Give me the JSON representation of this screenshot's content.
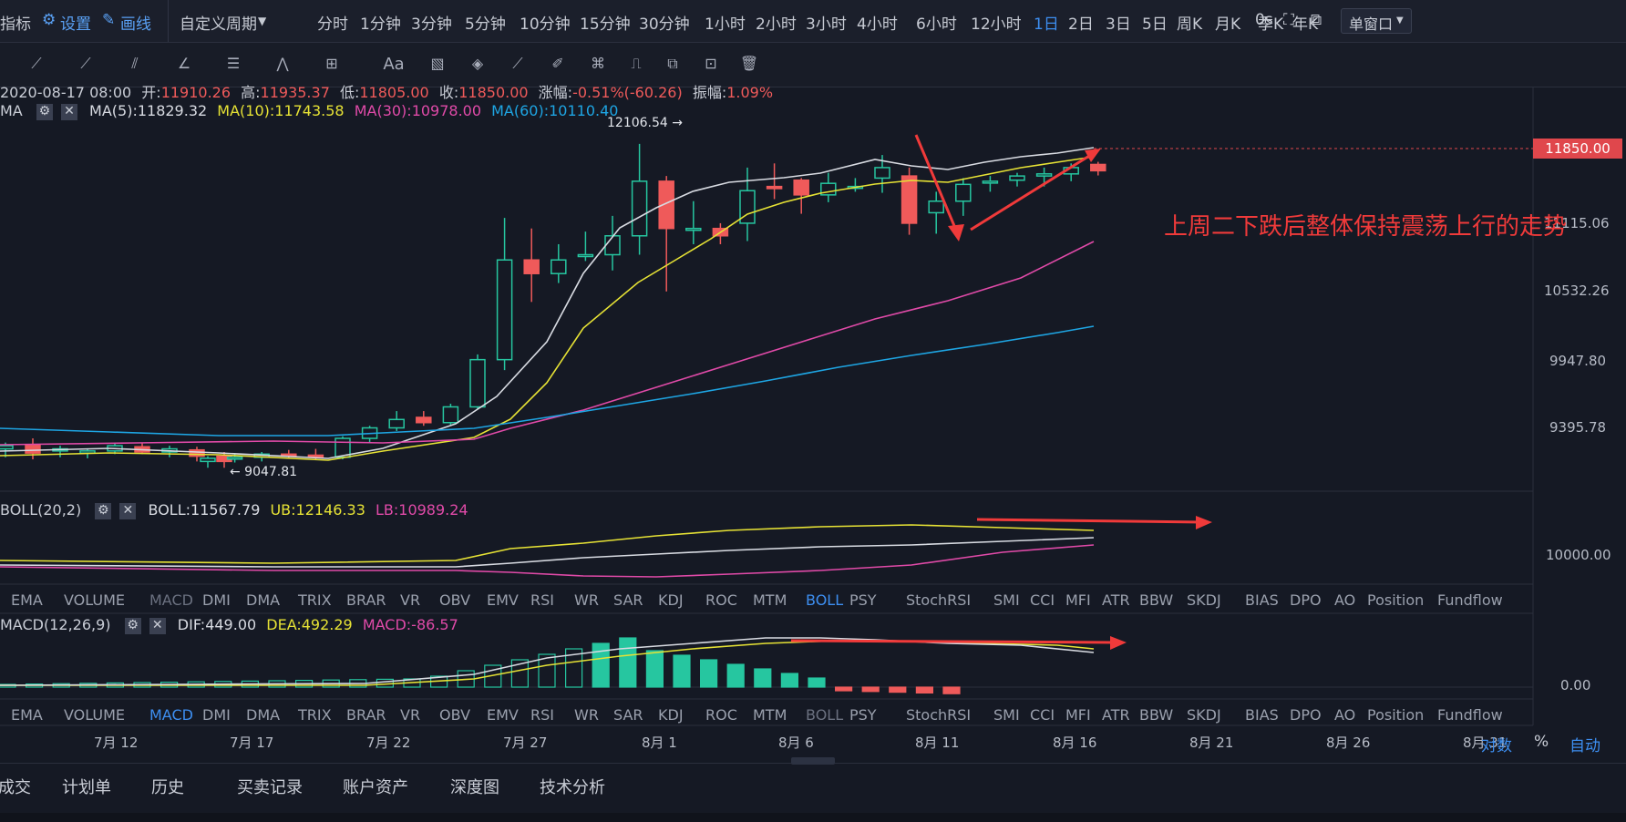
{
  "topbar": {
    "indicators_label": "指标",
    "settings_label": "设置",
    "draw_label": "画线",
    "custom_period_label": "自定义周期",
    "periods": [
      "分时",
      "1分钟",
      "3分钟",
      "5分钟",
      "10分钟",
      "15分钟",
      "30分钟",
      "1小时",
      "2小时",
      "3小时",
      "4小时",
      "6小时",
      "12小时",
      "1日",
      "2日",
      "3日",
      "5日",
      "周K",
      "月K",
      "季K",
      "年K"
    ],
    "active_period": "1日",
    "timer": "0s",
    "window_mode": "单窗口"
  },
  "toolbar": {
    "tools": [
      "line-tool",
      "ray-tool",
      "parallel-tool",
      "angle-tool",
      "fib-tool",
      "wave-tool",
      "box-tool",
      "text-tool",
      "brush-tool",
      "eraser-tool",
      "ruler-tool",
      "pen-tool",
      "pattern-tool",
      "lock-tool",
      "copy-tool",
      "measure-tool",
      "trash-tool"
    ],
    "text_tool_label": "Aa"
  },
  "ohlc": {
    "datetime": "2020-08-17 08:00",
    "open_label": "开:",
    "open": "11910.26",
    "high_label": "高:",
    "high": "11935.37",
    "low_label": "低:",
    "low": "11805.00",
    "close_label": "收:",
    "close": "11850.00",
    "change_label": "涨幅:",
    "change": "-0.51%(-60.26)",
    "amplitude_label": "振幅:",
    "amplitude": "1.09%"
  },
  "ma": {
    "label": "MA",
    "ma5": "MA(5):11829.32",
    "ma10": "MA(10):11743.58",
    "ma30": "MA(30):10978.00",
    "ma60": "MA(60):10110.40",
    "high_marker": "12106.54 →",
    "low_marker": "← 9047.81"
  },
  "price_axis": {
    "current": "11850.00",
    "ticks": [
      "11115.06",
      "10532.26",
      "9947.80",
      "9395.78"
    ]
  },
  "annotation": "上周二下跌后整体保持震荡上行的走势",
  "boll": {
    "label": "BOLL(20,2)",
    "mid": "BOLL:11567.79",
    "ub": "UB:12146.33",
    "lb": "LB:10989.24",
    "axis": "10000.00"
  },
  "indicator_tabs": [
    "EMA",
    "VOLUME",
    "MACD",
    "DMI",
    "DMA",
    "TRIX",
    "BRAR",
    "VR",
    "OBV",
    "EMV",
    "RSI",
    "WR",
    "SAR",
    "KDJ",
    "ROC",
    "MTM",
    "BOLL",
    "PSY",
    "StochRSI",
    "SMI",
    "CCI",
    "MFI",
    "ATR",
    "BBW",
    "SKDJ",
    "BIAS",
    "DPO",
    "AO",
    "Position",
    "Fundflow"
  ],
  "macd": {
    "label": "MACD(12,26,9)",
    "dif": "DIF:449.00",
    "dea": "DEA:492.29",
    "macd": "MACD:-86.57",
    "axis": "0.00"
  },
  "date_axis": [
    "7月 12",
    "7月 17",
    "7月 22",
    "7月 27",
    "8月 1",
    "8月 6",
    "8月 11",
    "8月 16",
    "8月 21",
    "8月 26",
    "8月 31"
  ],
  "axis_controls": {
    "percent": "%",
    "log": "对数",
    "auto": "自动"
  },
  "bottom_tabs": [
    "成交",
    "计划单",
    "历史",
    "买卖记录",
    "账户资产",
    "深度图",
    "技术分析"
  ],
  "colors": {
    "background": "#151924",
    "up": "#26c6a0",
    "down": "#ef5a5a",
    "ma5": "#d8dbe2",
    "ma10": "#e6e235",
    "ma30": "#e04aa8",
    "ma60": "#1ea5e3",
    "accent": "#3d8ef0"
  }
}
